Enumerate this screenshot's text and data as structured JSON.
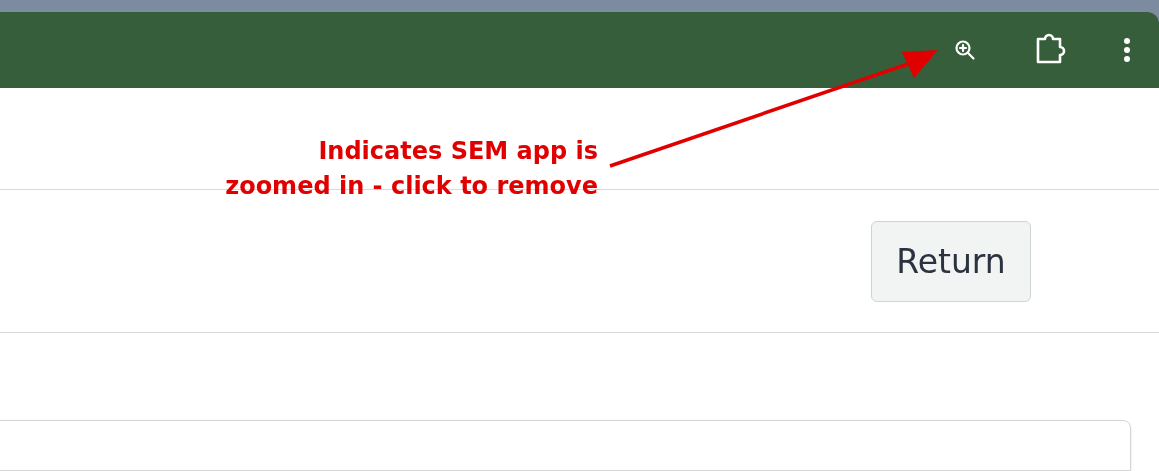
{
  "toolbar": {
    "icons": [
      {
        "kind": "zoom"
      },
      {
        "kind": "extension"
      },
      {
        "kind": "menu"
      }
    ]
  },
  "annotation": {
    "lines": [
      "Indicates SEM app is",
      "zoomed in - click to remove"
    ]
  },
  "return_button": {
    "label": "Return"
  }
}
